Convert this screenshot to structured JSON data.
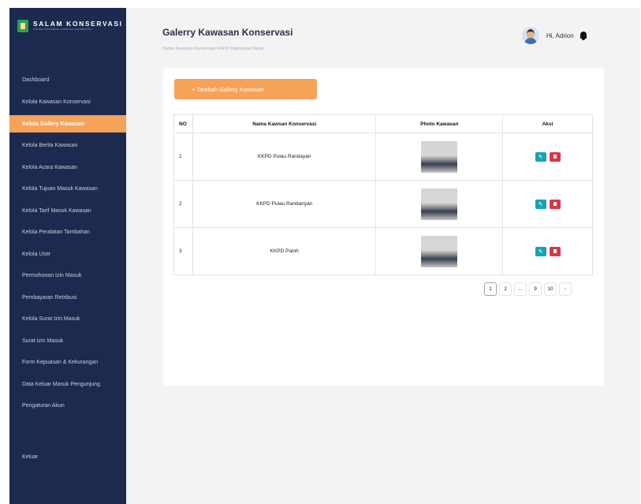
{
  "brand": {
    "title": "SALAM KONSERVASI",
    "subtitle": "SISTEM INFORMASI KAWASAN KONSERVASI"
  },
  "sidebar": {
    "items": [
      {
        "label": "Dashboard",
        "active": false
      },
      {
        "label": "Kelola Kawasan Konservasi",
        "active": false
      },
      {
        "label": "Kelola Gallery Kawasan",
        "active": true
      },
      {
        "label": "Kelola Berita Kawasan",
        "active": false
      },
      {
        "label": "Kelola Acara Kawasan",
        "active": false
      },
      {
        "label": "Kelola Tujuan Masuk Kawasan",
        "active": false
      },
      {
        "label": "Kelola Tarif Masuk Kawasan",
        "active": false
      },
      {
        "label": "Kelola Peralatan Tambahan",
        "active": false
      },
      {
        "label": "Kelola User",
        "active": false
      },
      {
        "label": "Permohonan Izin Masuk",
        "active": false
      },
      {
        "label": "Pembayaran Retribusi",
        "active": false
      },
      {
        "label": "Kelola Surat Izin Masuk",
        "active": false
      },
      {
        "label": "Surat Izin Masuk",
        "active": false
      },
      {
        "label": "Form Kepuasan & Kekurangan",
        "active": false
      },
      {
        "label": "Data Keluar Masuk Pengunjung",
        "active": false
      },
      {
        "label": "Pengaturan Akun",
        "active": false
      }
    ],
    "logout_label": "Keluar"
  },
  "header": {
    "title": "Galerry Kawasan Konservasi",
    "subtitle": "Daftar Kawasan Konservasi KKPD Kalimantan Barat",
    "greeting": "Hi, Adrion"
  },
  "main": {
    "add_button_label": "+ Tambah Gallery Kawasan",
    "table": {
      "headers": [
        "NO",
        "Nama Kawsan Konservasi",
        "Photo Kawasan",
        "Aksi"
      ],
      "rows": [
        {
          "no": "1",
          "name": "KKPD Pulau Randayan"
        },
        {
          "no": "2",
          "name": "KKPD Pulau Randanyan"
        },
        {
          "no": "3",
          "name": "KKPD Paloh"
        }
      ]
    },
    "pagination": [
      "1",
      "2",
      "...",
      "9",
      "10",
      ">"
    ],
    "current_page": "1"
  },
  "colors": {
    "sidebar_bg": "#1b2a4e",
    "accent": "#f7a259",
    "edit": "#17a2b8",
    "delete": "#dc3545"
  },
  "icons": {
    "brand": "logo-icon",
    "user": "avatar-icon",
    "notification": "bell-icon",
    "edit": "pencil-icon",
    "delete": "trash-icon"
  }
}
